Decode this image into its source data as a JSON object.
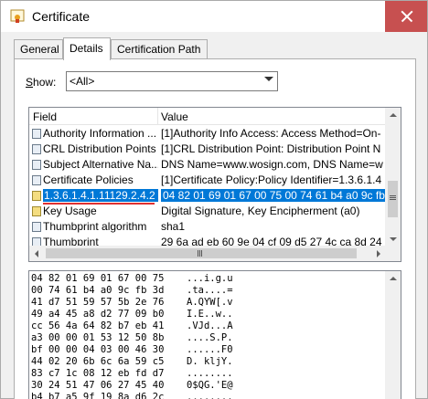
{
  "window": {
    "title": "Certificate",
    "icon": "certificate-icon"
  },
  "tabs": [
    {
      "label": "General",
      "active": false
    },
    {
      "label": "Details",
      "active": true
    },
    {
      "label": "Certification Path",
      "active": false
    }
  ],
  "show": {
    "label_prefix": "S",
    "label_rest": "how:",
    "value": "<All>"
  },
  "list": {
    "col_field": "Field",
    "col_value": "Value",
    "rows": [
      {
        "field": "Authority Information ...",
        "value": "[1]Authority Info Access: Access Method=On-",
        "icon": "certificate-field-icon",
        "selected": false
      },
      {
        "field": "CRL Distribution Points",
        "value": "[1]CRL Distribution Point: Distribution Point N",
        "icon": "certificate-field-icon",
        "selected": false
      },
      {
        "field": "Subject Alternative Na...",
        "value": "DNS Name=www.wosign.com, DNS Name=w",
        "icon": "certificate-field-icon",
        "selected": false
      },
      {
        "field": "Certificate Policies",
        "value": "[1]Certificate Policy:Policy Identifier=1.3.6.1.4",
        "icon": "certificate-field-icon",
        "selected": false
      },
      {
        "field": "1.3.6.1.4.1.11129.2.4.2",
        "value": "04 82 01 69 01 67 00 75 00 74 61 b4 a0 9c fb",
        "icon": "certificate-warning-icon",
        "selected": true
      },
      {
        "field": "Key Usage",
        "value": "Digital Signature, Key Encipherment (a0)",
        "icon": "certificate-warning-icon",
        "selected": false
      },
      {
        "field": "Thumbprint algorithm",
        "value": "sha1",
        "icon": "certificate-field-icon",
        "selected": false
      },
      {
        "field": "Thumbprint",
        "value": "29 6a ad eb 60 9e 04 cf 09 d5 27 4c ca 8d 24",
        "icon": "certificate-field-icon",
        "selected": false
      }
    ]
  },
  "hex": [
    {
      "hex": "04 82 01 69 01 67 00 75",
      "ascii": "...i.g.u"
    },
    {
      "hex": "00 74 61 b4 a0 9c fb 3d",
      "ascii": ".ta....="
    },
    {
      "hex": "41 d7 51 59 57 5b 2e 76",
      "ascii": "A.QYW[.v"
    },
    {
      "hex": "49 a4 45 a8 d2 77 09 b0",
      "ascii": "I.E..w.."
    },
    {
      "hex": "cc 56 4a 64 82 b7 eb 41",
      "ascii": ".VJd...A"
    },
    {
      "hex": "a3 00 00 01 53 12 50 8b",
      "ascii": "....S.P."
    },
    {
      "hex": "bf 00 00 04 03 00 46 30",
      "ascii": "......F0"
    },
    {
      "hex": "44 02 20 6b 6c 6a 59 c5",
      "ascii": "D. kljY."
    },
    {
      "hex": "83 c7 1c 08 12 eb fd d7",
      "ascii": "........"
    },
    {
      "hex": "30 24 51 47 06 27 45 40",
      "ascii": "0$QG.'E@"
    },
    {
      "hex": "b4 b7 a5 9f 19 8a d6 2c",
      "ascii": ".......,"
    }
  ]
}
